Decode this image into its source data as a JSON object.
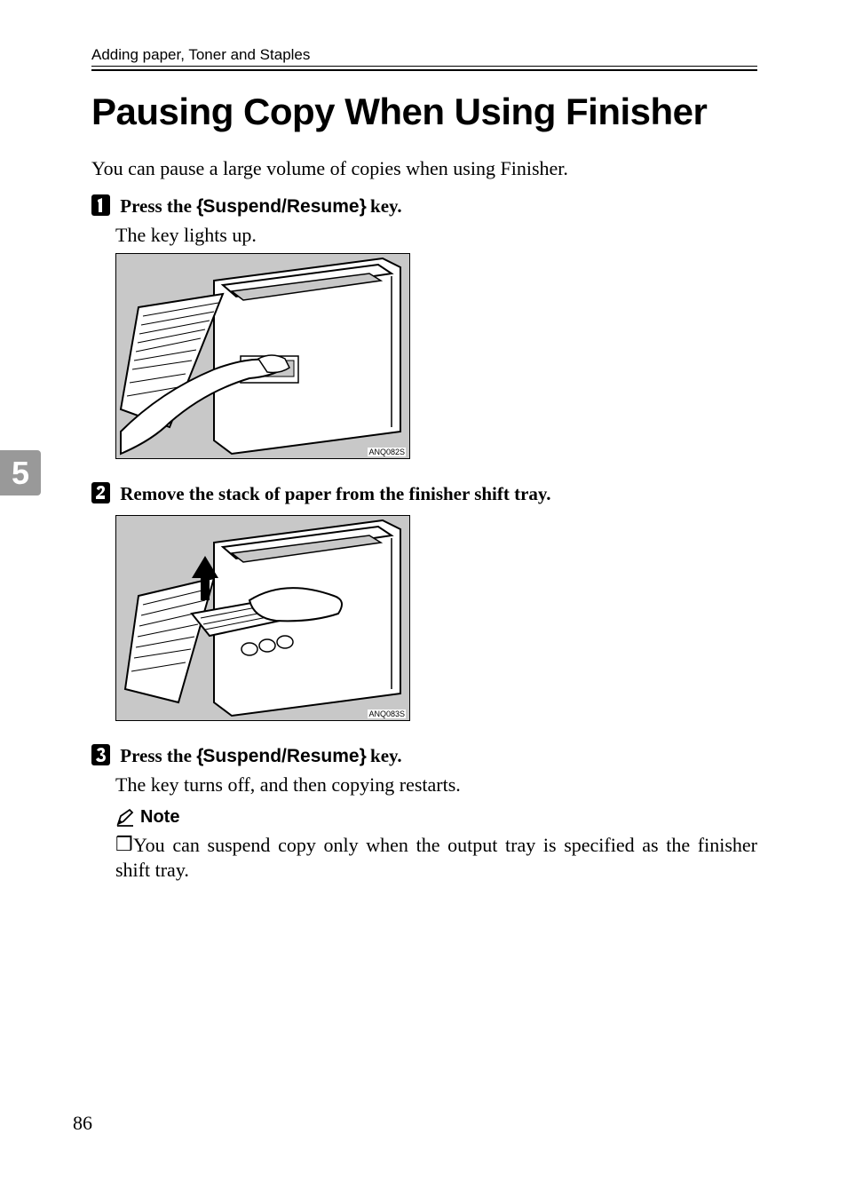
{
  "header": {
    "running_head": "Adding paper, Toner and Staples"
  },
  "title": "Pausing Copy When Using Finisher",
  "intro": "You can pause a large volume of copies when using Finisher.",
  "chapter_tab": "5",
  "steps": {
    "s1": {
      "prefix": "Press the ",
      "key": "Suspend/Resume",
      "suffix": " key.",
      "body": "The key lights up.",
      "img_code": "ANQ082S"
    },
    "s2": {
      "text": "Remove the stack of paper from the finisher shift tray.",
      "img_code": "ANQ083S"
    },
    "s3": {
      "prefix": "Press the ",
      "key": "Suspend/Resume",
      "suffix": " key.",
      "body": "The key turns off, and then copying restarts."
    }
  },
  "note": {
    "label": "Note",
    "body": "You can suspend copy only when the output tray is specified as the finisher shift tray."
  },
  "page_number": "86"
}
